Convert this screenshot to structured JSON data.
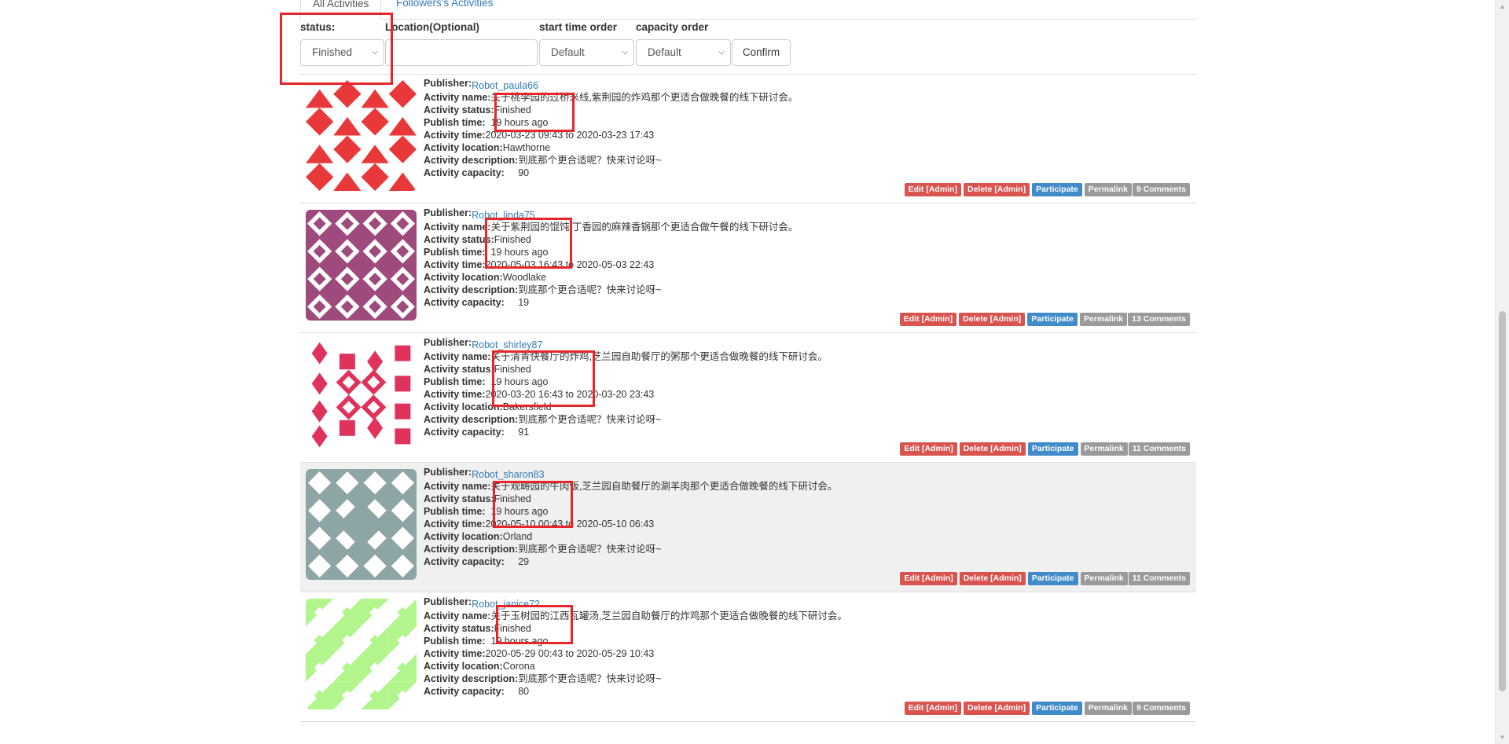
{
  "tabs": {
    "all": "All Activities",
    "followers": "Followers's Activities"
  },
  "filters": {
    "status_label": "status:",
    "status_value": "Finished",
    "location_label": "Location(Optional)",
    "location_value": "",
    "start_label": "start time order",
    "start_value": "Default",
    "capacity_label": "capacity order",
    "capacity_value": "Default",
    "confirm": "Confirm"
  },
  "labels": {
    "publisher": "Publisher:",
    "name": "Activity name:",
    "status": "Activity status:",
    "publish_time": "Publish time:",
    "time": "Activity time:",
    "location": "Activity location:",
    "description": "Activity description:",
    "capacity": "Activity capacity:"
  },
  "buttons": {
    "edit": "Edit [Admin]",
    "delete": "Delete [Admin]",
    "participate": "Participate",
    "permalink": "Permalink"
  },
  "activities": [
    {
      "publisher": "Robot_paula66",
      "name": "关于桃李园的过桥米线,紫荆园的炸鸡那个更适合做晚餐的线下研讨会。",
      "status": "Finished",
      "publish_time": "19 hours ago",
      "time": "2020-03-23 09:43 to 2020-03-23 17:43",
      "location": "Hawthorne",
      "description": "到底那个更合适呢？快来讨论呀~",
      "capacity": "90",
      "comments": "9 Comments",
      "avatar_color": "#e8383a"
    },
    {
      "publisher": "Robot_linda75",
      "name": "关于紫荆园的馄饨,丁香园的麻辣香锅那个更适合做午餐的线下研讨会。",
      "status": "Finished",
      "publish_time": "19 hours ago",
      "time": "2020-05-03 16:43 to 2020-05-03 22:43",
      "location": "Woodlake",
      "description": "到底那个更合适呢？快来讨论呀~",
      "capacity": "19",
      "comments": "13 Comments",
      "avatar_color": "#9e4a7c"
    },
    {
      "publisher": "Robot_shirley87",
      "name": "关于清青快餐厅的炸鸡,芝兰园自助餐厅的粥那个更适合做晚餐的线下研讨会。",
      "status": "Finished",
      "publish_time": "19 hours ago",
      "time": "2020-03-20 16:43 to 2020-03-20 23:43",
      "location": "Bakersfield",
      "description": "到底那个更合适呢？快来讨论呀~",
      "capacity": "91",
      "comments": "11 Comments",
      "avatar_color": "#e0335c"
    },
    {
      "publisher": "Robot_sharon83",
      "name": "关于观畴园的牛肉饭,芝兰园自助餐厅的涮羊肉那个更适合做晚餐的线下研讨会。",
      "status": "Finished",
      "publish_time": "19 hours ago",
      "time": "2020-05-10 00:43 to 2020-05-10 06:43",
      "location": "Orland",
      "description": "到底那个更合适呢？快来讨论呀~",
      "capacity": "29",
      "comments": "11 Comments",
      "avatar_color": "#8ea5a6"
    },
    {
      "publisher": "Robot_janice72",
      "name": "关于玉树园的江西瓦罐汤,芝兰园自助餐厅的炸鸡那个更适合做晚餐的线下研讨会。",
      "status": "Finished",
      "publish_time": "19 hours ago",
      "time": "2020-05-29 00:43 to 2020-05-29 10:43",
      "location": "Corona",
      "description": "到底那个更合适呢？快来讨论呀~",
      "capacity": "80",
      "comments": "9 Comments",
      "avatar_color": "#b1f58c"
    }
  ]
}
